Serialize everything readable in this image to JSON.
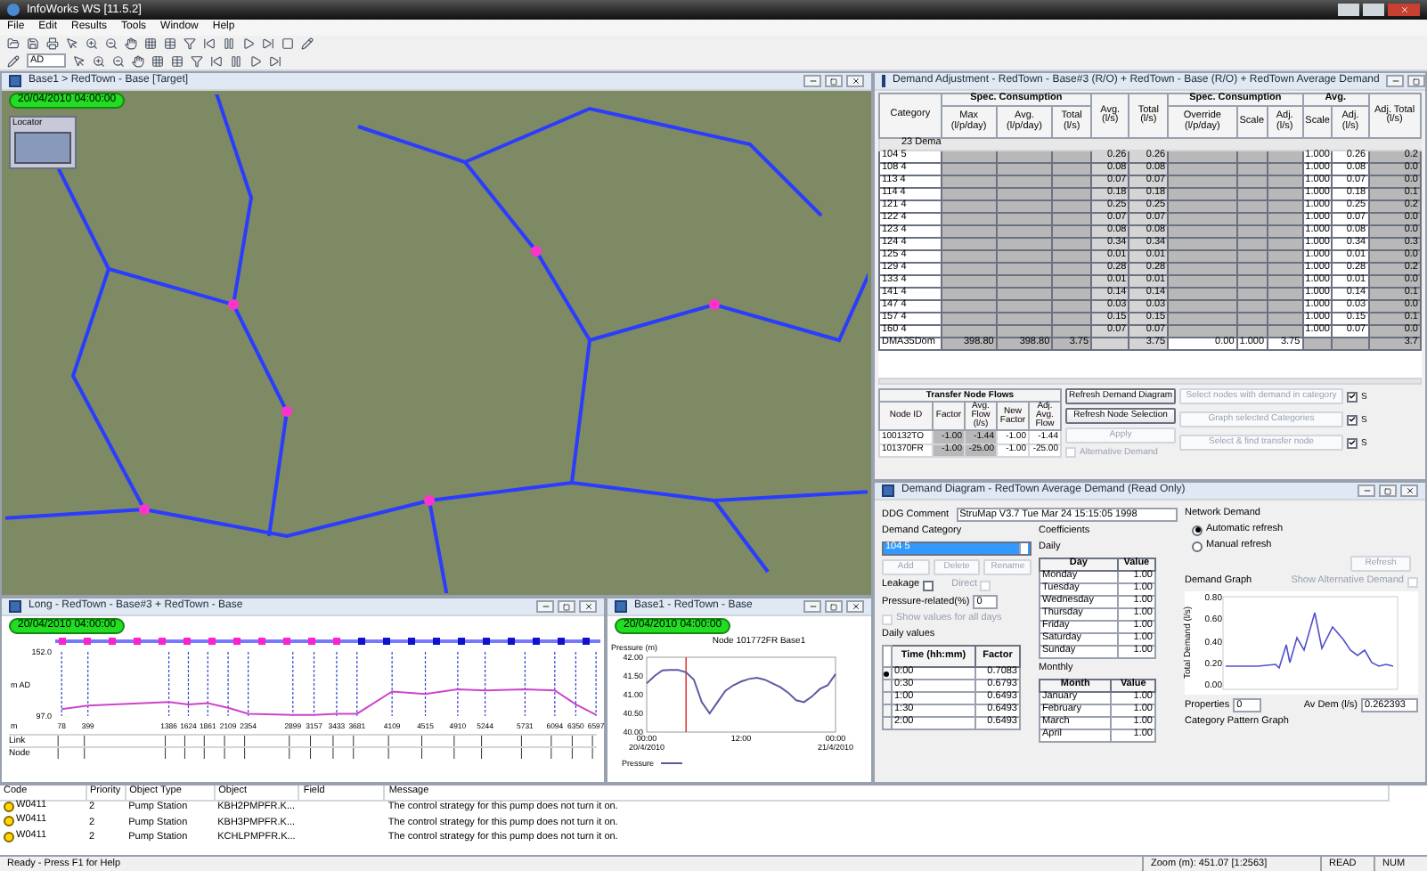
{
  "app": {
    "title": "InfoWorks WS [11.5.2]"
  },
  "menu": [
    "File",
    "Edit",
    "Results",
    "Tools",
    "Window",
    "Help"
  ],
  "toolbar": {
    "combo_value": "AD"
  },
  "map_window": {
    "title": "Base1 > RedTown - Base [Target]",
    "timestamp": "20/04/2010 04:00:00",
    "locator": "Locator"
  },
  "long_window": {
    "title": "Long - RedTown - Base#3 + RedTown - Base",
    "timestamp": "20/04/2010 04:00:00",
    "bands": [
      "Link",
      "Node"
    ],
    "chart_data": {
      "type": "line",
      "xlabel": "m",
      "ylabel": "m AD",
      "x": [
        78,
        399,
        1386,
        1624,
        1861,
        2109,
        2354,
        2899,
        3157,
        3433,
        3681,
        4109,
        4515,
        4910,
        5244,
        5731,
        6094,
        6350,
        6597
      ],
      "grid": true,
      "series": [
        {
          "color": "#cc44cc",
          "values": [
            103,
            106,
            109,
            107,
            108,
            104,
            99,
            98,
            98,
            99,
            99,
            118,
            116,
            120,
            119,
            120,
            119,
            107,
            98
          ]
        }
      ],
      "xlim": [
        0,
        6650
      ],
      "ylim": [
        97,
        152
      ],
      "xticks": [
        78,
        399,
        1386,
        1624,
        1861,
        2109,
        2354,
        2899,
        3157,
        3433,
        3681,
        4109,
        4515,
        4910,
        5244,
        5731,
        6094,
        6350,
        6597
      ],
      "yticks": [
        {
          "value": 97,
          "label": "97.0"
        },
        {
          "value": 152,
          "label": "152.0"
        }
      ]
    }
  },
  "graph_window": {
    "title": "Base1 - RedTown - Base",
    "timestamp": "20/04/2010 04:00:00",
    "chart_data": {
      "type": "line",
      "title": "Node 101772FR Base1",
      "ylabel": "Pressure (m)",
      "categories": [
        "00:00 20/4/2010",
        null,
        null,
        null,
        null,
        null,
        null,
        null,
        null,
        null,
        null,
        null,
        "12:00",
        null,
        null,
        null,
        null,
        null,
        null,
        null,
        null,
        null,
        null,
        null,
        "00:00 21/4/2010"
      ],
      "series": [
        {
          "name": "Pressure",
          "color": "#5a5aa0",
          "values": [
            41.3,
            41.5,
            41.65,
            41.66,
            41.66,
            41.6,
            41.4,
            40.8,
            40.5,
            40.8,
            41.1,
            41.25,
            41.35,
            41.42,
            41.45,
            41.4,
            41.3,
            41.2,
            41.05,
            40.85,
            40.8,
            40.95,
            41.15,
            41.25,
            41.55
          ]
        }
      ],
      "ylim": [
        40,
        42
      ],
      "yticks": [
        {
          "value": 40,
          "label": "40.00"
        },
        {
          "value": 40.5,
          "label": "40.50"
        },
        {
          "value": 41,
          "label": "41.00"
        },
        {
          "value": 41.5,
          "label": "41.50"
        },
        {
          "value": 42,
          "label": "42.00"
        }
      ]
    }
  },
  "demand_adjustment": {
    "title": "Demand Adjustment - RedTown - Base#3 (R/O) + RedTown - Base (R/O) + RedTown Average Demand",
    "header_rows": [
      [
        {
          "label": "Category",
          "rowspan": 2
        },
        {
          "label": "Spec. Consumption",
          "colspan": 3
        },
        {
          "label": "Avg. (l/s)",
          "rowspan": 2
        },
        {
          "label": "Total (l/s)",
          "rowspan": 2
        },
        {
          "label": "Spec. Consumption",
          "colspan": 3
        },
        {
          "label": "Avg.",
          "colspan": 2
        },
        {
          "label": "Adj. Total (l/s)",
          "rowspan": 2
        }
      ],
      [
        {
          "label": "Max (l/p/day)"
        },
        {
          "label": "Avg. (l/p/day)"
        },
        {
          "label": "Total (l/s)"
        },
        {
          "label": "Override (l/p/day)"
        },
        {
          "label": "Scale"
        },
        {
          "label": "Adj. (l/s)"
        },
        {
          "label": "Scale"
        },
        {
          "label": "Adj. (l/s)"
        }
      ]
    ],
    "rows": [
      {
        "kind": "group",
        "cells": [
          "23 Dema"
        ]
      },
      {
        "kind": "category",
        "cells": [
          "104  5",
          "",
          "",
          "",
          "0.26",
          "0.26",
          "",
          "",
          "",
          "1.000",
          "0.26",
          "0.2"
        ]
      },
      {
        "kind": "category",
        "cells": [
          "108  4",
          "",
          "",
          "",
          "0.08",
          "0.08",
          "",
          "",
          "",
          "1.000",
          "0.08",
          "0.0"
        ]
      },
      {
        "kind": "category",
        "cells": [
          "113  4",
          "",
          "",
          "",
          "0.07",
          "0.07",
          "",
          "",
          "",
          "1.000",
          "0.07",
          "0.0"
        ]
      },
      {
        "kind": "category",
        "cells": [
          "114  4",
          "",
          "",
          "",
          "0.18",
          "0.18",
          "",
          "",
          "",
          "1.000",
          "0.18",
          "0.1"
        ]
      },
      {
        "kind": "category",
        "cells": [
          "121  4",
          "",
          "",
          "",
          "0.25",
          "0.25",
          "",
          "",
          "",
          "1.000",
          "0.25",
          "0.2"
        ]
      },
      {
        "kind": "category",
        "cells": [
          "122  4",
          "",
          "",
          "",
          "0.07",
          "0.07",
          "",
          "",
          "",
          "1.000",
          "0.07",
          "0.0"
        ]
      },
      {
        "kind": "category",
        "cells": [
          "123  4",
          "",
          "",
          "",
          "0.08",
          "0.08",
          "",
          "",
          "",
          "1.000",
          "0.08",
          "0.0"
        ]
      },
      {
        "kind": "category",
        "cells": [
          "124  4",
          "",
          "",
          "",
          "0.34",
          "0.34",
          "",
          "",
          "",
          "1.000",
          "0.34",
          "0.3"
        ]
      },
      {
        "kind": "category",
        "cells": [
          "125  4",
          "",
          "",
          "",
          "0.01",
          "0.01",
          "",
          "",
          "",
          "1.000",
          "0.01",
          "0.0"
        ]
      },
      {
        "kind": "category",
        "cells": [
          "129  4",
          "",
          "",
          "",
          "0.28",
          "0.28",
          "",
          "",
          "",
          "1.000",
          "0.28",
          "0.2"
        ]
      },
      {
        "kind": "category",
        "cells": [
          "133  4",
          "",
          "",
          "",
          "0.01",
          "0.01",
          "",
          "",
          "",
          "1.000",
          "0.01",
          "0.0"
        ]
      },
      {
        "kind": "category",
        "cells": [
          "141  4",
          "",
          "",
          "",
          "0.14",
          "0.14",
          "",
          "",
          "",
          "1.000",
          "0.14",
          "0.1"
        ]
      },
      {
        "kind": "category",
        "cells": [
          "147  4",
          "",
          "",
          "",
          "0.03",
          "0.03",
          "",
          "",
          "",
          "1.000",
          "0.03",
          "0.0"
        ]
      },
      {
        "kind": "category",
        "cells": [
          "157  4",
          "",
          "",
          "",
          "0.15",
          "0.15",
          "",
          "",
          "",
          "1.000",
          "0.15",
          "0.1"
        ]
      },
      {
        "kind": "category",
        "cells": [
          "160  4",
          "",
          "",
          "",
          "0.07",
          "0.07",
          "",
          "",
          "",
          "1.000",
          "0.07",
          "0.0"
        ]
      },
      {
        "kind": "total",
        "cells": [
          "DMA35Dom",
          "398.80",
          "398.80",
          "3.75",
          "",
          "3.75",
          "0.00",
          "1.000",
          "3.75",
          "",
          "",
          "3.7"
        ]
      }
    ],
    "transfer": {
      "title": "Transfer Node Flows",
      "columns": [
        "Node ID",
        "Factor",
        "Avg. Flow (l/s)",
        "New Factor",
        "Adj. Avg. Flow"
      ],
      "rows": [
        [
          "100132TO",
          "-1.00",
          "-1.44",
          "-1.00",
          "-1.44"
        ],
        [
          "101370FR",
          "-1.00",
          "-25.00",
          "-1.00",
          "-25.00"
        ]
      ]
    },
    "buttons": [
      {
        "label": "Refresh Demand Diagram",
        "disabled": false
      },
      {
        "label": "Refresh Node Selection",
        "disabled": false
      },
      {
        "label": "Apply",
        "disabled": true
      }
    ],
    "alternative_demand": {
      "label": "Alternative Demand",
      "checked": false,
      "disabled": true
    },
    "actions": [
      {
        "label": "Select nodes with demand in category",
        "disabled": true,
        "option": {
          "label": "S",
          "checked": true
        }
      },
      {
        "label": "Graph selected Categories",
        "disabled": true,
        "option": {
          "label": "S",
          "checked": true
        }
      },
      {
        "label": "Select & find transfer node",
        "disabled": true,
        "option": {
          "label": "S",
          "checked": true
        }
      }
    ]
  },
  "demand_diagram": {
    "title": "Demand Diagram - RedTown Average Demand (Read Only)",
    "comment_label": "DDG Comment",
    "comment": "StruMap V3.7 Tue Mar 24 15:15:05 1998",
    "category_group": "Demand Category",
    "category": "104  5",
    "category_buttons": [
      {
        "label": "Add",
        "disabled": true
      },
      {
        "label": "Delete",
        "disabled": true
      },
      {
        "label": "Rename",
        "disabled": true
      }
    ],
    "leakage": {
      "label": "Leakage",
      "checked": false,
      "disabled": false
    },
    "direct": {
      "label": "Direct",
      "checked": false,
      "disabled": true
    },
    "pressure_label": "Pressure-related(%)",
    "pressure": "0",
    "show_all_days": {
      "label": "Show values for all days",
      "checked": false,
      "disabled": true
    },
    "daily_values": {
      "title": "Daily values",
      "columns": [
        "Time (hh:mm)",
        "Factor"
      ],
      "rows": [
        {
          "cells": [
            "0:00",
            "0.7083"
          ],
          "selected": true
        },
        {
          "cells": [
            "0:30",
            "0.6793"
          ],
          "selected": false
        },
        {
          "cells": [
            "1:00",
            "0.6493"
          ],
          "selected": false
        },
        {
          "cells": [
            "1:30",
            "0.6493"
          ],
          "selected": false
        },
        {
          "cells": [
            "2:00",
            "0.6493"
          ],
          "selected": false
        }
      ]
    },
    "coefficients": {
      "title": "Coefficients",
      "daily_label": "Daily",
      "daily_columns": [
        "Day",
        "Value"
      ],
      "daily": [
        [
          "Monday",
          "1.00"
        ],
        [
          "Tuesday",
          "1.00"
        ],
        [
          "Wednesday",
          "1.00"
        ],
        [
          "Thursday",
          "1.00"
        ],
        [
          "Friday",
          "1.00"
        ],
        [
          "Saturday",
          "1.00"
        ],
        [
          "Sunday",
          "1.00"
        ]
      ],
      "monthly_label": "Monthly",
      "monthly_columns": [
        "Month",
        "Value"
      ],
      "monthly": [
        [
          "January",
          "1.00"
        ],
        [
          "February",
          "1.00"
        ],
        [
          "March",
          "1.00"
        ],
        [
          "April",
          "1.00"
        ]
      ]
    },
    "network": {
      "title": "Network Demand",
      "refresh_modes": [
        {
          "label": "Automatic refresh",
          "selected": true
        },
        {
          "label": "Manual refresh",
          "selected": false
        }
      ],
      "refresh_button": {
        "label": "Refresh",
        "disabled": true
      },
      "graph_label": "Demand Graph",
      "show_alternative": {
        "label": "Show Alternative Demand",
        "checked": false,
        "disabled": true
      },
      "y_label": "Total Demand (l/s)",
      "y_ticks": [
        "0.80",
        "0.60",
        "0.40",
        "0.20",
        "0.00"
      ],
      "properties_label": "Properties",
      "properties": "0",
      "avdem_label": "Av Dem (l/s)",
      "avdem": "0.262393"
    },
    "pattern_group": "Category Pattern Graph"
  },
  "messages": {
    "columns": [
      "Code",
      "Priority",
      "Object Type",
      "Object",
      "Field",
      "Message"
    ],
    "rows": [
      {
        "code": "W0411",
        "priority": "2",
        "object_type": "Pump Station",
        "object": "KBH2PMPFR.K...",
        "message": "The control strategy for this pump does not turn it on."
      },
      {
        "code": "W0411",
        "priority": "2",
        "object_type": "Pump Station",
        "object": "KBH3PMPFR.K...",
        "message": "The control strategy for this pump does not turn it on."
      },
      {
        "code": "W0411",
        "priority": "2",
        "object_type": "Pump Station",
        "object": "KCHLPMPFR.K...",
        "message": "The control strategy for this pump does not turn it on."
      }
    ]
  },
  "status_bar": {
    "message": "Ready - Press F1 for Help",
    "zoom": "Zoom (m): 451.07 [1:2563]",
    "read": "READ",
    "num": "NUM"
  }
}
